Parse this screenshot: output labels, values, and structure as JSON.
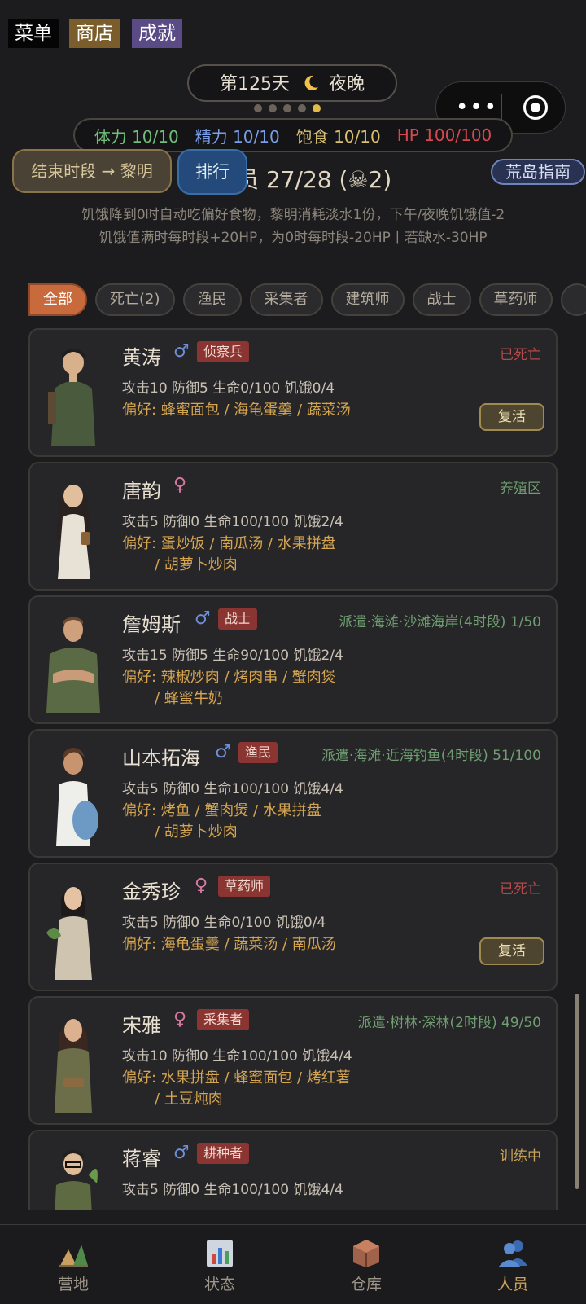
{
  "top_buttons": {
    "menu": "菜单",
    "shop": "商店",
    "achievements": "成就"
  },
  "day": {
    "label": "第125天",
    "moon_icon": "crescent-moon-icon",
    "period": "夜晚"
  },
  "capsule": {
    "more": "•••"
  },
  "stats": {
    "stamina": "体力 10/10",
    "energy": "精力 10/10",
    "satiety": "饱食 10/10",
    "hp": "HP 100/100"
  },
  "controls": {
    "end_period": "结束时段 → 黎明",
    "rank": "排行",
    "people_count": "人员 27/28 (☠2)",
    "guide": "荒岛指南"
  },
  "info": {
    "line1": "饥饿降到0时自动吃偏好食物，黎明消耗淡水1份，下午/夜晚饥饿值-2",
    "line2": "饥饿值满时每时段+20HP，为0时每时段-20HP丨若缺水-30HP"
  },
  "filters": [
    "全部",
    "死亡(2)",
    "渔民",
    "采集者",
    "建筑师",
    "战士",
    "草药师",
    ""
  ],
  "people": [
    {
      "name": "黄涛",
      "gender": "♂",
      "role": "侦察兵",
      "status": "已死亡",
      "attrs": "攻击10 防御5 生命0/100 饥饿0/4",
      "prefs": [
        "偏好: 蜂蜜面包 / 海龟蛋羹 / 蔬菜汤"
      ],
      "action": "复活"
    },
    {
      "name": "唐韵",
      "gender": "♀",
      "role": "",
      "status": "养殖区",
      "attrs": "攻击5 防御0 生命100/100 饥饿2/4",
      "prefs": [
        "偏好: 蛋炒饭 / 南瓜汤 / 水果拼盘",
        "/ 胡萝卜炒肉"
      ],
      "action": ""
    },
    {
      "name": "詹姆斯",
      "gender": "♂",
      "role": "战士",
      "status": "派遣·海滩·沙滩海岸(4时段) 1/50",
      "attrs": "攻击15 防御5 生命90/100 饥饿2/4",
      "prefs": [
        "偏好: 辣椒炒肉 / 烤肉串 / 蟹肉煲",
        "/ 蜂蜜牛奶"
      ],
      "action": ""
    },
    {
      "name": "山本拓海",
      "gender": "♂",
      "role": "渔民",
      "status": "派遣·海滩·近海钓鱼(4时段) 51/100",
      "attrs": "攻击5 防御0 生命100/100 饥饿4/4",
      "prefs": [
        "偏好: 烤鱼 / 蟹肉煲 / 水果拼盘",
        "/ 胡萝卜炒肉"
      ],
      "action": ""
    },
    {
      "name": "金秀珍",
      "gender": "♀",
      "role": "草药师",
      "status": "已死亡",
      "attrs": "攻击5 防御0 生命0/100 饥饿0/4",
      "prefs": [
        "偏好: 海龟蛋羹 / 蔬菜汤 / 南瓜汤"
      ],
      "action": "复活"
    },
    {
      "name": "宋雅",
      "gender": "♀",
      "role": "采集者",
      "status": "派遣·树林·深林(2时段) 49/50",
      "attrs": "攻击10 防御0 生命100/100 饥饿4/4",
      "prefs": [
        "偏好: 水果拼盘 / 蜂蜜面包 / 烤红薯",
        "/ 土豆炖肉"
      ],
      "action": ""
    },
    {
      "name": "蒋睿",
      "gender": "♂",
      "role": "耕种者",
      "status": "训练中",
      "attrs": "攻击5 防御0 生命100/100 饥饿4/4",
      "prefs": [],
      "action": ""
    }
  ],
  "tabs": [
    {
      "label": "营地",
      "icon": "camp-icon"
    },
    {
      "label": "状态",
      "icon": "status-chart-icon"
    },
    {
      "label": "仓库",
      "icon": "warehouse-box-icon"
    },
    {
      "label": "人员",
      "icon": "people-icon"
    }
  ],
  "active_tab": "人员"
}
